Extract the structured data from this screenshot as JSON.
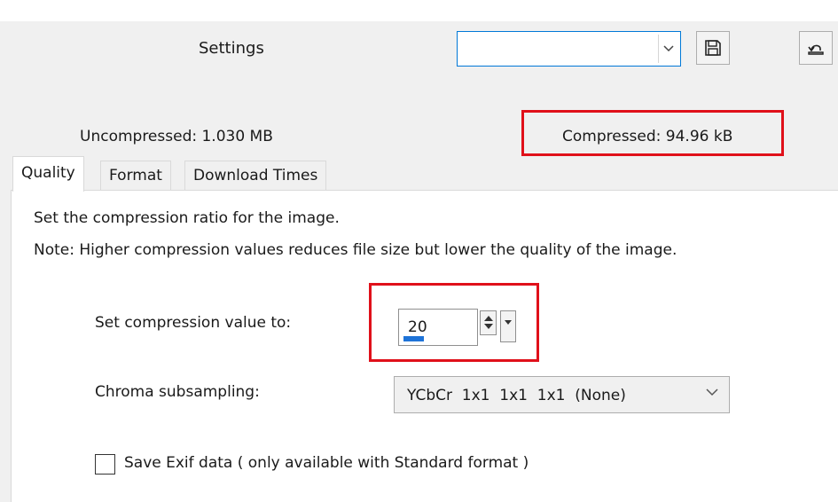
{
  "header": {
    "settings_label": "Settings",
    "preset_value": ""
  },
  "stats": {
    "uncompressed": "Uncompressed:  1.030 MB",
    "compressed": "Compressed: 94.96 kB"
  },
  "tabs": [
    {
      "label": "Quality",
      "active": true
    },
    {
      "label": "Format",
      "active": false
    },
    {
      "label": "Download Times",
      "active": false
    }
  ],
  "quality": {
    "description": "Set the compression ratio for the image.",
    "note": "Note:  Higher compression values reduces file size but lower the quality of the image.",
    "compression_label": "Set compression value to:",
    "compression_value": "20",
    "compression_level_fraction": 0.2,
    "chroma_label": "Chroma subsampling:",
    "chroma_value": "YCbCr  1x1  1x1  1x1  (None)",
    "exif_label": "Save Exif data ( only available with Standard format )",
    "exif_checked": false
  },
  "colors": {
    "highlight": "#e0101a",
    "accent": "#0078d7",
    "progress": "#1e73d8"
  },
  "icons": {
    "save": "floppy-disk-icon",
    "restore": "restore-defaults-icon"
  }
}
